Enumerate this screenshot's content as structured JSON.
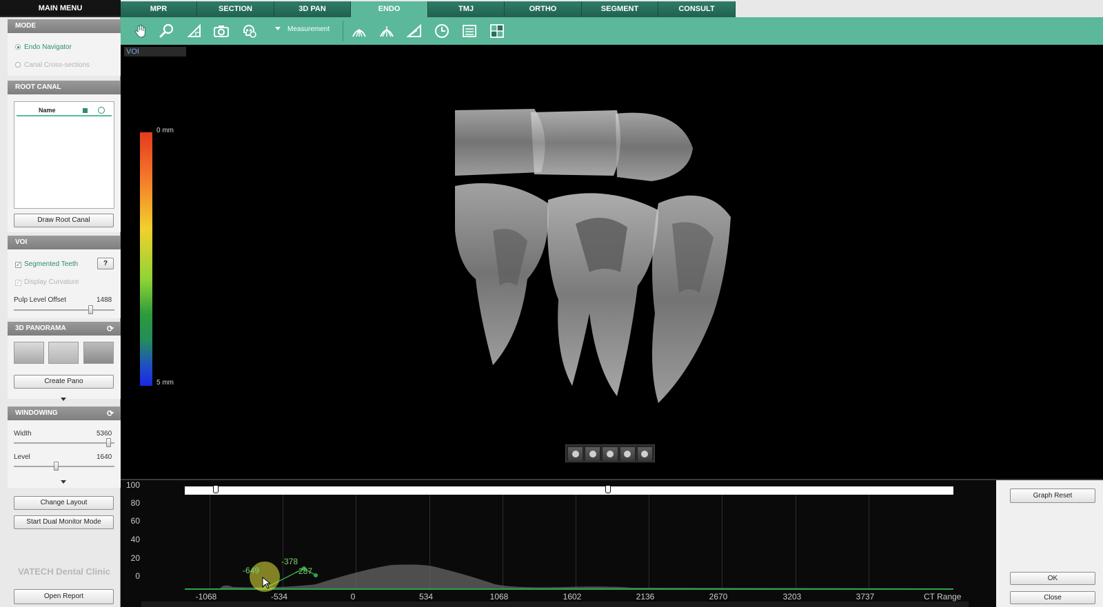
{
  "left": {
    "main_menu": "MAIN MENU",
    "mode": {
      "title": "MODE",
      "options": [
        {
          "label": "Endo Navigator",
          "selected": true
        },
        {
          "label": "Canal Cross-sections",
          "selected": false
        }
      ]
    },
    "root_canal": {
      "title": "ROOT CANAL",
      "list_header": "Name",
      "button": "Draw Root Canal"
    },
    "voi": {
      "title": "VOI",
      "segmented": "Segmented Teeth",
      "help": "?",
      "curvature": "Display Curvature",
      "pulp_label": "Pulp Level Offset",
      "pulp_value": "1488"
    },
    "panorama": {
      "title": "3D PANORAMA",
      "button": "Create Pano"
    },
    "windowing": {
      "title": "WINDOWING",
      "width_label": "Width",
      "width_value": "5360",
      "level_label": "Level",
      "level_value": "1640"
    },
    "change_layout": "Change Layout",
    "dual_monitor": "Start Dual Monitor Mode",
    "clinic": "VATECH Dental Clinic",
    "open_report": "Open Report"
  },
  "tabs": [
    "MPR",
    "SECTION",
    "3D PAN",
    "ENDO",
    "TMJ",
    "ORTHO",
    "SEGMENT",
    "CONSULT"
  ],
  "active_tab": "ENDO",
  "toolbar": {
    "measurement": "Measurement",
    "icons": [
      "hand-icon",
      "zoom-icon",
      "angle-icon",
      "camera-icon",
      "skull-icon",
      "canal-icon",
      "canal2-icon",
      "ruler-icon",
      "rotate-icon",
      "layers-icon",
      "grid-icon"
    ]
  },
  "viewport": {
    "voi_label": "VOI",
    "colorbar_top": "0 mm",
    "colorbar_bottom": "5 mm"
  },
  "graph": {
    "y_ticks": [
      "100",
      "80",
      "60",
      "40",
      "20",
      "0"
    ],
    "x_ticks": [
      "-1068",
      "-534",
      "0",
      "534",
      "1068",
      "1602",
      "2136",
      "2670",
      "3203",
      "3737"
    ],
    "x_label": "CT Range",
    "points": [
      "-649",
      "-378",
      "-287"
    ]
  },
  "right_panel": {
    "graph_reset": "Graph Reset",
    "ok": "OK",
    "close": "Close"
  },
  "colors": {
    "accent": "#5bb89a",
    "tab": "#2f7d69",
    "active_text": "#2e8c70"
  }
}
